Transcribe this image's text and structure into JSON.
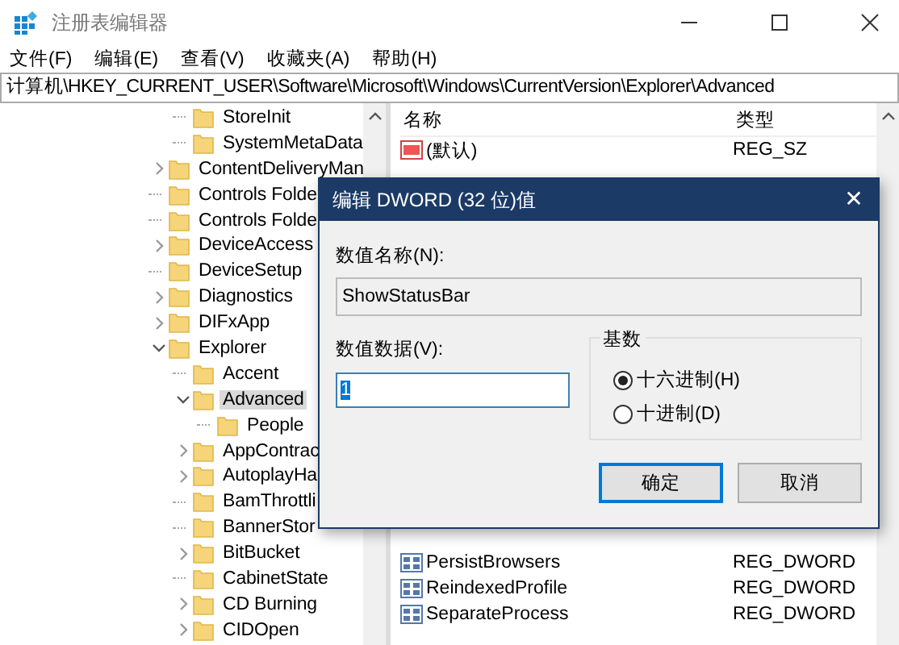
{
  "window": {
    "title": "注册表编辑器"
  },
  "menu": [
    "文件(F)",
    "编辑(E)",
    "查看(V)",
    "收藏夹(A)",
    "帮助(H)"
  ],
  "address": "计算机\\HKEY_CURRENT_USER\\Software\\Microsoft\\Windows\\CurrentVersion\\Explorer\\Advanced",
  "tree": {
    "continued_children": [
      {
        "label": "StoreInit",
        "expandable": false,
        "selected": false
      },
      {
        "label": "SystemMetaData",
        "expandable": false,
        "selected": false
      }
    ],
    "items": [
      {
        "label": "ContentDeliveryMan",
        "expandable": true,
        "expanded": false,
        "selected": false
      },
      {
        "label": "Controls Folde",
        "expandable": false,
        "selected": false
      },
      {
        "label": "Controls Folde",
        "expandable": false,
        "selected": false
      },
      {
        "label": "DeviceAccess",
        "expandable": true,
        "expanded": false,
        "selected": false
      },
      {
        "label": "DeviceSetup",
        "expandable": false,
        "selected": false
      },
      {
        "label": "Diagnostics",
        "expandable": true,
        "expanded": false,
        "selected": false
      },
      {
        "label": "DIFxApp",
        "expandable": true,
        "expanded": false,
        "selected": false
      },
      {
        "label": "Explorer",
        "expandable": true,
        "expanded": true,
        "selected": false,
        "children": [
          {
            "label": "Accent",
            "expandable": false,
            "selected": false
          },
          {
            "label": "Advanced",
            "expandable": true,
            "expanded": true,
            "selected": true,
            "children": [
              {
                "label": "People",
                "expandable": false,
                "selected": false
              }
            ]
          },
          {
            "label": "AppContrac",
            "expandable": true,
            "expanded": false,
            "selected": false
          },
          {
            "label": "AutoplayHa",
            "expandable": true,
            "expanded": false,
            "selected": false
          },
          {
            "label": "BamThrottli",
            "expandable": false,
            "selected": false
          },
          {
            "label": "BannerStor",
            "expandable": false,
            "selected": false
          },
          {
            "label": "BitBucket",
            "expandable": true,
            "expanded": false,
            "selected": false
          },
          {
            "label": "CabinetState",
            "expandable": false,
            "selected": false
          },
          {
            "label": "CD Burning",
            "expandable": true,
            "expanded": false,
            "selected": false
          },
          {
            "label": "CIDOpen",
            "expandable": true,
            "expanded": false,
            "selected": false
          }
        ]
      }
    ]
  },
  "list": {
    "columns": [
      "名称",
      "类型"
    ],
    "rows_top": [
      {
        "name": "(默认)",
        "type": "REG_SZ",
        "kind": "string"
      }
    ],
    "rows_bottom": [
      {
        "name": "PersistBrowsers",
        "type": "REG_DWORD",
        "kind": "dword"
      },
      {
        "name": "ReindexedProfile",
        "type": "REG_DWORD",
        "kind": "dword"
      },
      {
        "name": "SeparateProcess",
        "type": "REG_DWORD",
        "kind": "dword"
      }
    ]
  },
  "dialog": {
    "title": "编辑 DWORD (32 位)值",
    "close": "✕",
    "name_label": "数值名称(N):",
    "name_value": "ShowStatusBar",
    "data_label": "数值数据(V):",
    "data_value": "1",
    "base_label": "基数",
    "bases": [
      {
        "label": "十六进制(H)",
        "selected": true
      },
      {
        "label": "十进制(D)",
        "selected": false
      }
    ],
    "buttons": [
      {
        "label": "确定",
        "default": true
      },
      {
        "label": "取消",
        "default": false
      }
    ]
  }
}
